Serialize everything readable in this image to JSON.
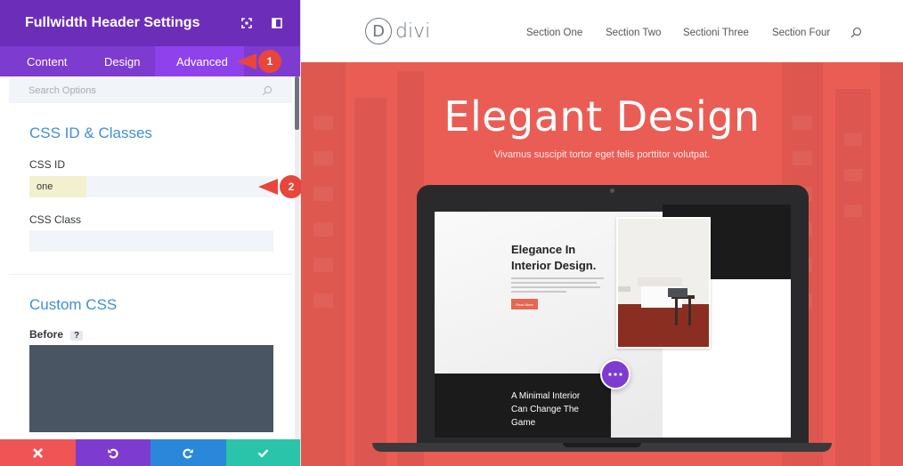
{
  "panel": {
    "title": "Fullwidth Header Settings",
    "header_icons": [
      "expand-icon",
      "sidebar-toggle-icon"
    ],
    "tabs": [
      {
        "label": "Content",
        "active": false
      },
      {
        "label": "Design",
        "active": false
      },
      {
        "label": "Advanced",
        "active": true
      }
    ],
    "search": {
      "placeholder": "Search Options",
      "icon": "search-icon"
    },
    "css_section": {
      "title": "CSS ID & Classes",
      "css_id_label": "CSS ID",
      "css_id_value": "one",
      "css_class_label": "CSS Class",
      "css_class_value": ""
    },
    "custom_css": {
      "title": "Custom CSS",
      "before_label": "Before",
      "help": "?",
      "before_value": ""
    },
    "bottom_actions": [
      {
        "name": "discard",
        "icon": "close-icon",
        "color": "#ef5555"
      },
      {
        "name": "undo",
        "icon": "undo-icon",
        "color": "#7e3bd0"
      },
      {
        "name": "redo",
        "icon": "redo-icon",
        "color": "#2b87da"
      },
      {
        "name": "save",
        "icon": "check-icon",
        "color": "#29c4a9"
      }
    ]
  },
  "callouts": [
    "1",
    "2"
  ],
  "site": {
    "logo_letter": "D",
    "logo_text": "divi",
    "nav": [
      "Section One",
      "Section Two",
      "Sectioni Three",
      "Section Four"
    ],
    "nav_search_icon": "search-icon",
    "hero_title": "Elegant Design",
    "hero_subtitle": "Vivamus suscipit tortor eget felis porttitor volutpat.",
    "hero_color": "#ea5d55",
    "mockup": {
      "heading_line1": "Elegance In",
      "heading_line2": "Interior Design.",
      "button": "Read More",
      "footer_line1": "A Minimal Interior",
      "footer_line2": "Can Change The",
      "footer_line3": "Game"
    },
    "fab_icon": "more-dots-icon"
  },
  "colors": {
    "brand_purple": "#6c2eb9",
    "tab_purple": "#7e3bd0",
    "accent_blue": "#3f8fd3",
    "callout_red": "#e8453c"
  }
}
